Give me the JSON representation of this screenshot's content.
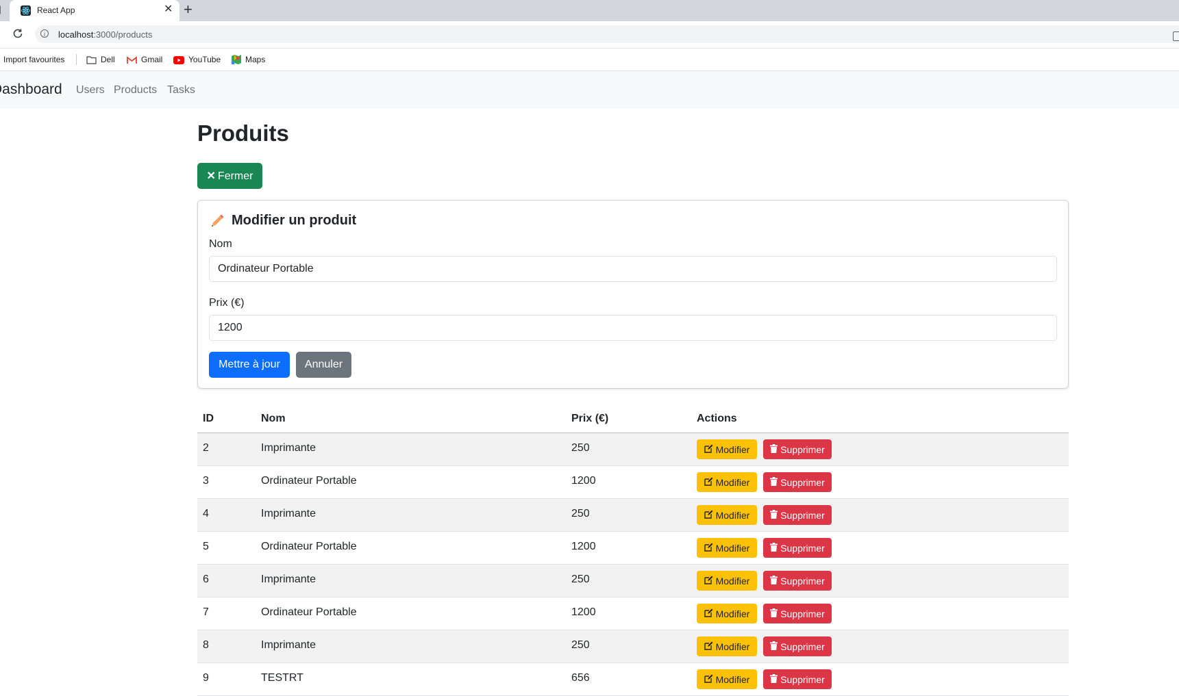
{
  "browser": {
    "tab_title": "React App",
    "url_host": "localhost",
    "url_path": ":3000/products",
    "bookmarks": [
      "Import favourites",
      "Dell",
      "Gmail",
      "YouTube",
      "Maps"
    ]
  },
  "navbar": {
    "brand": "Dashboard",
    "links": [
      "Users",
      "Products",
      "Tasks"
    ]
  },
  "page": {
    "title": "Produits",
    "close_button": "Fermer"
  },
  "form": {
    "title": "Modifier un produit",
    "name_label": "Nom",
    "name_value": "Ordinateur Portable",
    "price_label": "Prix (€)",
    "price_value": "1200",
    "update_button": "Mettre à jour",
    "cancel_button": "Annuler"
  },
  "table": {
    "headers": [
      "ID",
      "Nom",
      "Prix (€)",
      "Actions"
    ],
    "edit_label": "Modifier",
    "delete_label": "Supprimer",
    "rows": [
      {
        "id": "2",
        "nom": "Imprimante",
        "prix": "250"
      },
      {
        "id": "3",
        "nom": "Ordinateur Portable",
        "prix": "1200"
      },
      {
        "id": "4",
        "nom": "Imprimante",
        "prix": "250"
      },
      {
        "id": "5",
        "nom": "Ordinateur Portable",
        "prix": "1200"
      },
      {
        "id": "6",
        "nom": "Imprimante",
        "prix": "250"
      },
      {
        "id": "7",
        "nom": "Ordinateur Portable",
        "prix": "1200"
      },
      {
        "id": "8",
        "nom": "Imprimante",
        "prix": "250"
      },
      {
        "id": "9",
        "nom": "TESTRT",
        "prix": "656"
      }
    ]
  },
  "colors": {
    "success": "#198754",
    "primary": "#0d6efd",
    "secondary": "#6c757d",
    "warning": "#ffc107",
    "danger": "#dc3545"
  }
}
